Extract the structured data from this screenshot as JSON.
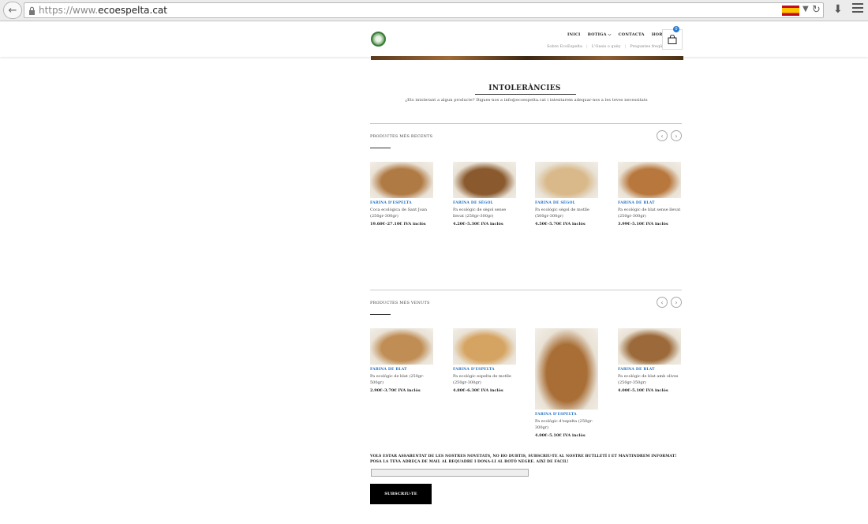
{
  "browser": {
    "url_prefix": "https://www.",
    "url_domain": "ecoespelta.cat"
  },
  "header": {
    "nav": [
      "INICI",
      "BOTIGA ⌵",
      "CONTACTA",
      "HORARIS"
    ],
    "subnav": [
      "Sobre EcoEspelta",
      "L'Oasis o quèy",
      "Preguntes freqüents ⌵"
    ],
    "cart_count": "0"
  },
  "intolerancies": {
    "title": "INTOLERÀNCIES",
    "text": "¿Ets intolerant a algun producte? Digues-nos a info@ecoespelta.cat i intentarem adequar-nos a les teves necessitats"
  },
  "recent": {
    "title": "PRODUCTES MÉS RECENTS",
    "products": [
      {
        "cat": "FARINA D'ESPELTA",
        "name": "Coca ecològica de Sant Joan (250gr-300gr)",
        "price": "19.60€–27.10€ IVA inclòs",
        "img": "#b07a44"
      },
      {
        "cat": "FARINA DE SÈGOL",
        "name": "Pa ecològic de sègol sense llevat (250gr-300gr)",
        "price": "4.20€–5.30€ IVA inclòs",
        "img": "#8a5a2e"
      },
      {
        "cat": "FARINA DE SÈGOL",
        "name": "Pa ecològic sègol de motlle (500gr-300gr)",
        "price": "4.50€–5.70€ IVA inclòs",
        "img": "#d9b98a"
      },
      {
        "cat": "FARINA DE BLAT",
        "name": "Pa ecològic de blat sense llevat (250gr-300gr)",
        "price": "3.99€–5.10€ IVA inclòs",
        "img": "#b8773c"
      }
    ]
  },
  "sold": {
    "title": "PRODUCTES MÉS VENUTS",
    "products": [
      {
        "cat": "FARINA DE BLAT",
        "name": "Pa ecològic de blat (250gr-500gr)",
        "price": "2.90€–3.70€ IVA inclòs",
        "img": "#c08d55"
      },
      {
        "cat": "FARINA D'ESPELTA",
        "name": "Pa ecològic espelta de motlle (250gr-300gr)",
        "price": "4.80€–6.30€ IVA inclòs",
        "img": "#d6a462"
      },
      {
        "cat": "FARINA D'ESPELTA",
        "name": "Pa ecològic d'espelta (250gr-300gr)",
        "price": "4.00€–5.10€ IVA inclòs",
        "img": "#a86e36"
      },
      {
        "cat": "FARINA DE BLAT",
        "name": "Pa ecològic de blat amb olives (250gr-350gr)",
        "price": "4.00€–5.10€ IVA inclòs",
        "img": "#9c6a3a"
      }
    ]
  },
  "newsletter": {
    "text": "VOLS ESTAR ASSABENTAT DE LES NOSTRES NOVETATS, NO HO DUBTIS, SUBSCRIU-TE AL NOSTRE BUTLLETÍ I ET MANTINDREM INFORMAT! POSA LA TEVA ADREÇA DE MAIL AL REQUADRE I DONA-LI AL BOTÓ NEGRE. AIXÍ DE FÀCIL!",
    "button": "SUBSCRIU-TE"
  }
}
